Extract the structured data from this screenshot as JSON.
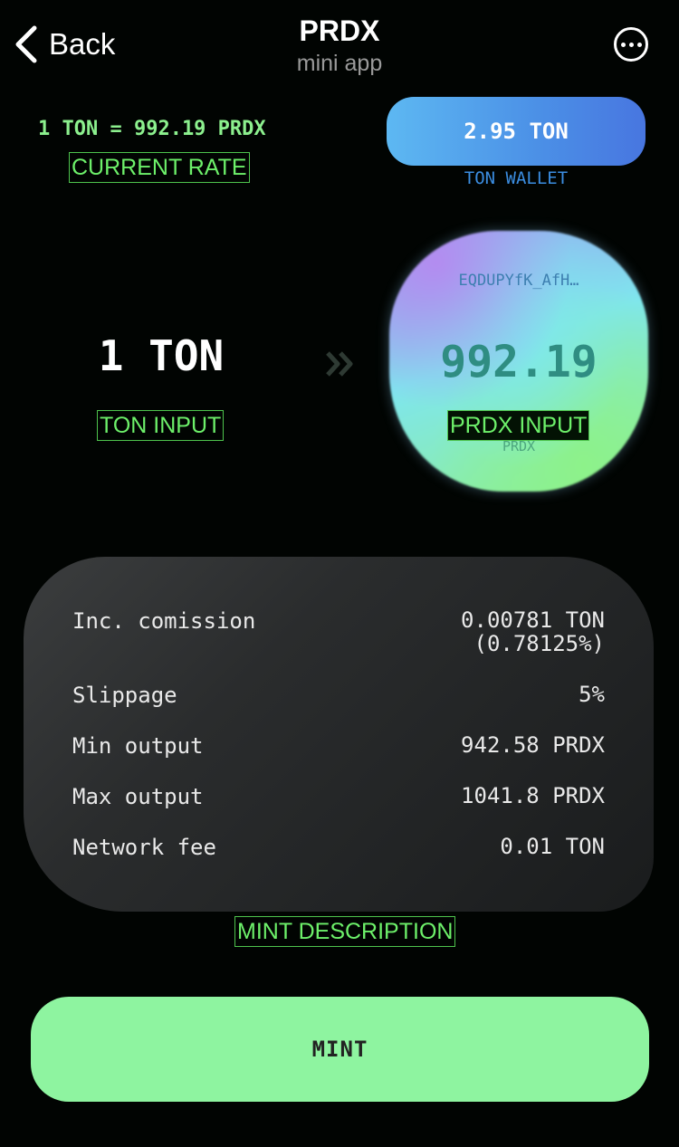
{
  "header": {
    "back_label": "Back",
    "title": "PRDX",
    "subtitle": "mini app"
  },
  "rate": {
    "text": "1 TON = 992.19 PRDX",
    "tag": "CURRENT RATE"
  },
  "wallet": {
    "balance": "2.95 TON",
    "label": "TON WALLET"
  },
  "ton_input": {
    "value": "1 TON",
    "tag": "TON INPUT"
  },
  "prdx_input": {
    "address": "EQDUPYfK_AfH…",
    "value": "992.19",
    "unit": "PRDX",
    "tag": "PRDX INPUT"
  },
  "description": {
    "rows": [
      {
        "label": "Inc. comission",
        "value": "0.00781 TON",
        "sub": "(0.78125%)"
      },
      {
        "label": "Slippage",
        "value": "5%"
      },
      {
        "label": "Min output",
        "value": "942.58 PRDX"
      },
      {
        "label": "Max output",
        "value": "1041.8 PRDX"
      },
      {
        "label": "Network fee",
        "value": "0.01 TON"
      }
    ],
    "tag": "MINT DESCRIPTION"
  },
  "mint": {
    "label": "MINT"
  },
  "colors": {
    "accent_green": "#8ef4a0",
    "rate_green": "#8cf08e",
    "wallet_blue": "#4b8fe6",
    "background": "#010402"
  },
  "icons": [
    "chevron-left-icon",
    "more-icon",
    "double-chevron-right-icon"
  ]
}
